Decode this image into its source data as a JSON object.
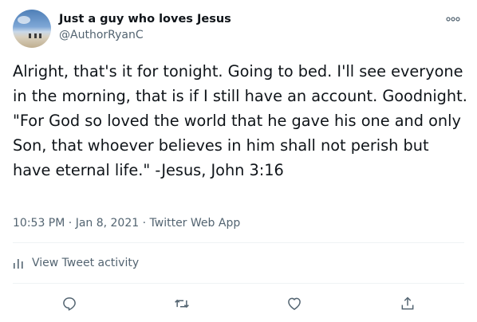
{
  "author": {
    "display_name": "Just a guy who loves Jesus",
    "handle": "@AuthorRyanC",
    "avatar_icon": "beach-photo-avatar"
  },
  "tweet": {
    "text": "Alright, that's it for tonight. Going to bed. I'll see everyone in the morning, that is if I still have an account. Goodnight.\n\"For God so loved the world that he gave his one and only Son, that whoever believes in him shall not perish but have eternal life.\" -Jesus, John 3:16",
    "time": "10:53 PM",
    "separator1": "·",
    "date": "Jan 8, 2021",
    "separator2": "·",
    "source": "Twitter Web App"
  },
  "activity": {
    "label": "View Tweet activity",
    "icon": "bar-chart-icon"
  },
  "actions": [
    {
      "name": "reply",
      "icon": "reply-icon"
    },
    {
      "name": "retweet",
      "icon": "retweet-icon"
    },
    {
      "name": "like",
      "icon": "heart-icon"
    },
    {
      "name": "share",
      "icon": "share-icon"
    }
  ],
  "colors": {
    "text_primary": "#0f1419",
    "text_secondary": "#536471",
    "divider": "#eff3f4"
  }
}
